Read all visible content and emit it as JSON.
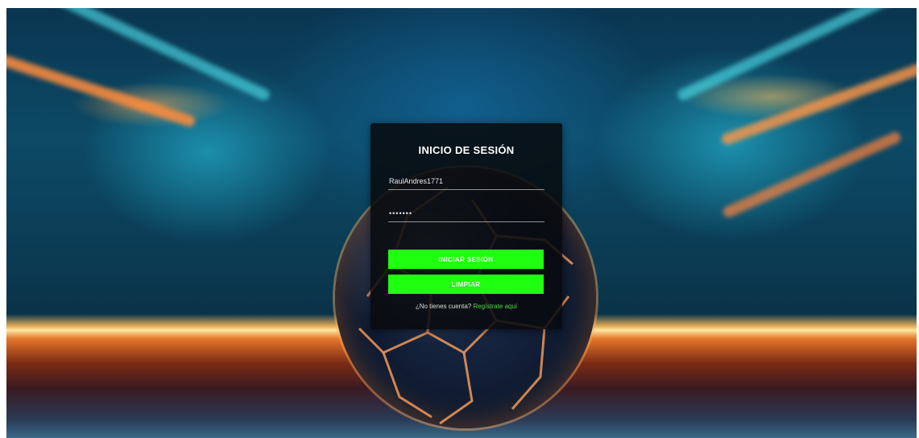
{
  "login": {
    "title": "INICIO DE SESIÓN",
    "username_value": "RaulAndres1771",
    "password_value": "•••••••",
    "login_button": "INICIAR SESIÓN",
    "clear_button": "LIMPIAR",
    "no_account_text": "¿No tienes cuenta?",
    "register_link": "Regístrate aquí"
  },
  "colors": {
    "button_bg": "#1fff10",
    "card_bg": "#080a0e",
    "link": "#4fd34a"
  }
}
